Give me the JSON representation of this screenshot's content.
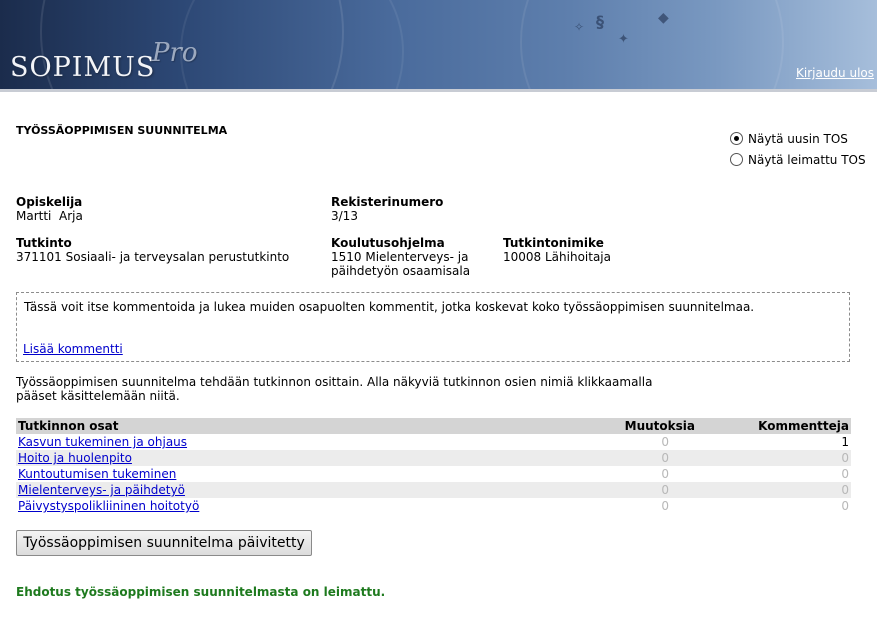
{
  "header": {
    "logo_main": "SOPIMUS",
    "logo_pro": "Pro",
    "logout": "Kirjaudu ulos"
  },
  "page_title": "TYÖSSÄOPPIMISEN SUUNNITELMA",
  "view_options": [
    {
      "label": "Näytä uusin TOS",
      "selected": true
    },
    {
      "label": "Näytä leimattu TOS",
      "selected": false
    }
  ],
  "student": {
    "label": "Opiskelija",
    "value": "Martti  Arja"
  },
  "register": {
    "label": "Rekisterinumero",
    "value": "3/13"
  },
  "degree": {
    "label": "Tutkinto",
    "value": "371101 Sosiaali- ja terveysalan perustutkinto"
  },
  "program": {
    "label": "Koulutusohjelma",
    "value_line1": "1510 Mielenterveys- ja",
    "value_line2": "päihdetyön osaamisala"
  },
  "title_degree": {
    "label": "Tutkintonimike",
    "value": "10008 Lähihoitaja"
  },
  "comments": {
    "text": "Tässä voit itse kommentoida ja lukea muiden osapuolten kommentit, jotka koskevat koko työssäoppimisen suunnitelmaa.",
    "add_link": "Lisää kommentti"
  },
  "intro": {
    "line1": "Työssäoppimisen suunnitelma tehdään tutkinnon osittain. Alla näkyviä tutkinnon osien nimiä klikkaamalla",
    "line2": "pääset käsittelemään niitä."
  },
  "parts_table": {
    "headers": [
      "Tutkinnon osat",
      "Muutoksia",
      "Kommentteja"
    ],
    "rows": [
      {
        "name": "Kasvun tukeminen ja ohjaus",
        "changes": "0",
        "comments": "1"
      },
      {
        "name": "Hoito ja huolenpito",
        "changes": "0",
        "comments": "0"
      },
      {
        "name": "Kuntoutumisen tukeminen",
        "changes": "0",
        "comments": "0"
      },
      {
        "name": "Mielenterveys- ja päihdetyö",
        "changes": "0",
        "comments": "0"
      },
      {
        "name": "Päivystyspolikliininen hoitotyö",
        "changes": "0",
        "comments": "0"
      }
    ]
  },
  "update_button": "Työssäoppimisen suunnitelma päivitetty",
  "status_message": "Ehdotus työssäoppimisen suunnitelmasta on leimattu.",
  "colors": {
    "link": "#0000cc",
    "status": "#1e7a1e",
    "table_header": "#d4d4d4"
  }
}
